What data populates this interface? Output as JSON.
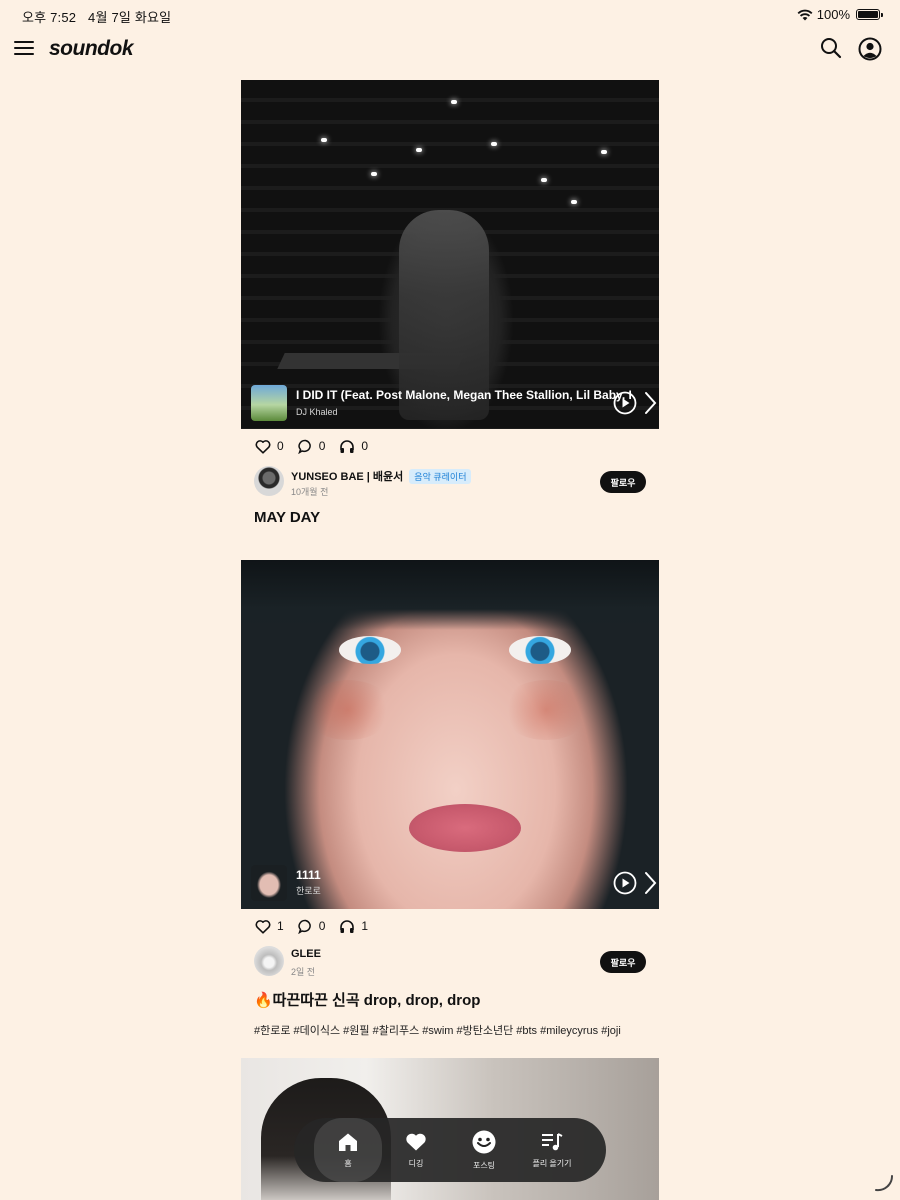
{
  "status_bar": {
    "time": "오후 7:52",
    "date": "4월 7일 화요일",
    "battery": "100%"
  },
  "header": {
    "logo": "soundok"
  },
  "posts": [
    {
      "track_title": "I DID IT (Feat. Post Malone, Megan Thee Stallion, Lil Baby, DaBaby)",
      "track_artist": "DJ Khaled",
      "likes": "0",
      "comments": "0",
      "listens": "0",
      "author": "YUNSEO BAE | 배윤서",
      "badge": "음악 큐레이터",
      "time": "10개월 전",
      "follow": "팔로우",
      "title": "MAY DAY"
    },
    {
      "track_title": "1111",
      "track_artist": "한로로",
      "likes": "1",
      "comments": "0",
      "listens": "1",
      "author": "GLEE",
      "time": "2일 전",
      "follow": "팔로우",
      "title": "🔥따끈따끈 신곡 drop, drop, drop",
      "tags": "#한로로 #데이식스 #원필 #찰리푸스 #swim #방탄소년단 #bts #mileycyrus #joji"
    }
  ],
  "bottom_nav": [
    {
      "label": "홈",
      "icon": "home-icon"
    },
    {
      "label": "디깅",
      "icon": "heart-icon"
    },
    {
      "label": "포스팅",
      "icon": "posting-icon"
    },
    {
      "label": "플리 올기기",
      "icon": "playlist-icon"
    }
  ]
}
